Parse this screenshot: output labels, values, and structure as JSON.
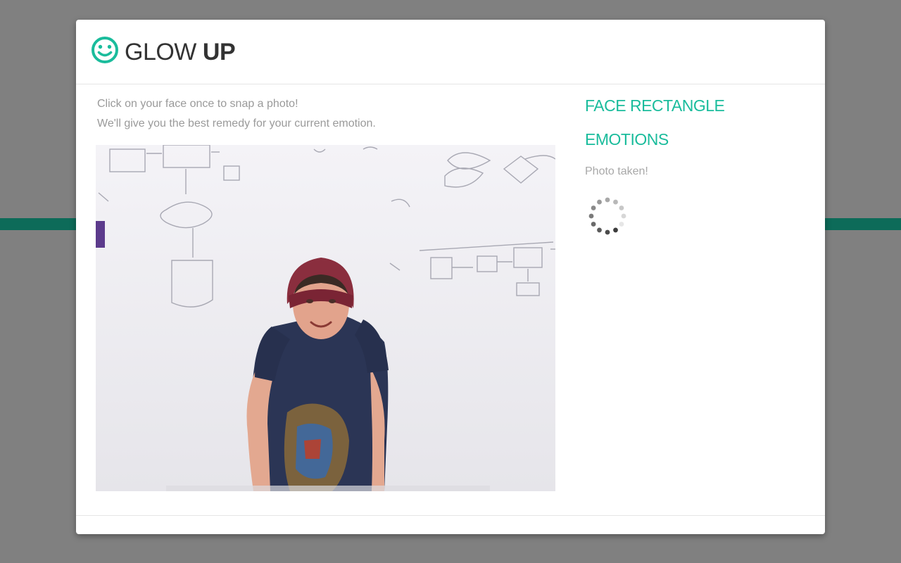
{
  "app": {
    "name_light": "GLOW",
    "name_bold": "UP",
    "logo_icon": "smiley-icon"
  },
  "colors": {
    "accent": "#1abc9c",
    "backdrop": "#808080",
    "backdrop_stripe": "#0d6b59",
    "muted_text": "#9a9a9a"
  },
  "instructions": {
    "line1": "Click on your face once to snap a photo!",
    "line2": "We'll give you the best remedy for your current emotion."
  },
  "photo": {
    "content": "webcam snapshot of smiling man in red beanie and navy t-shirt in front of whiteboard flowchart"
  },
  "results": {
    "face_rectangle_heading": "FACE RECTANGLE",
    "emotions_heading": "EMOTIONS",
    "status": "Photo taken!",
    "loading_icon": "loading-spinner-icon"
  }
}
